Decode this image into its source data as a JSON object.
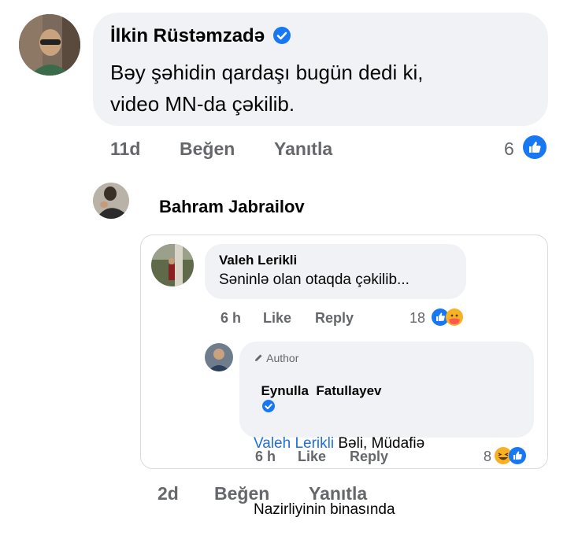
{
  "comment1": {
    "author": "İlkin Rüstəmzadə",
    "text_line1": "Bəy şəhidin qardaşı bugün dedi ki,",
    "text_line2": "video MN-da çəkilib.",
    "time": "11d",
    "like_label": "Beğen",
    "reply_label": "Yanıtla",
    "reaction_count": "6"
  },
  "comment2": {
    "author": "Bahram Jabrailov",
    "time": "2d",
    "like_label": "Beğen",
    "reply_label": "Yanıtla"
  },
  "shared": {
    "reply1": {
      "author": "Valeh Lerikli",
      "text": "Səninlə olan otaqda çəkilib...",
      "time": "6 h",
      "like_label": "Like",
      "reply_label": "Reply",
      "reaction_count": "18"
    },
    "reply2": {
      "badge": "Author",
      "author": "Eynulla  Fatullayev",
      "mention": "Valeh Lerikli",
      "text_line1_rest": " Bəli, Müdafiə",
      "text_line2": "Nazirliyinin binasında",
      "time": "6 h",
      "like_label": "Like",
      "reply_label": "Reply",
      "reaction_count": "8"
    }
  },
  "colors": {
    "verified": "#1877f2",
    "link": "#216fdb",
    "meta": "#65676b",
    "bubble": "#f0f2f5"
  }
}
